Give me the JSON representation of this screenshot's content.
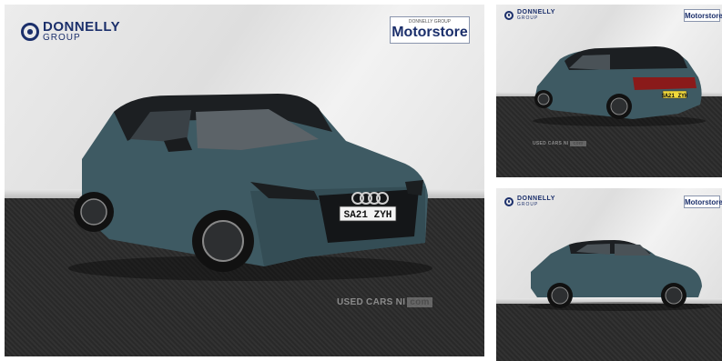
{
  "brand": {
    "dealer_name": "DONNELLY",
    "dealer_sub": "GROUP",
    "partner_small": "DONNELLY GROUP",
    "partner_name": "Motorstore",
    "primary_color": "#1b2f6b"
  },
  "car": {
    "registration": "SA21 ZYH",
    "paint_color": "#3e5a63"
  },
  "watermark": {
    "text": "USED CARS NI",
    "badge": "com"
  },
  "gallery": {
    "main_view": "front-three-quarter",
    "thumb_views": [
      "rear-three-quarter",
      "side-profile"
    ]
  }
}
